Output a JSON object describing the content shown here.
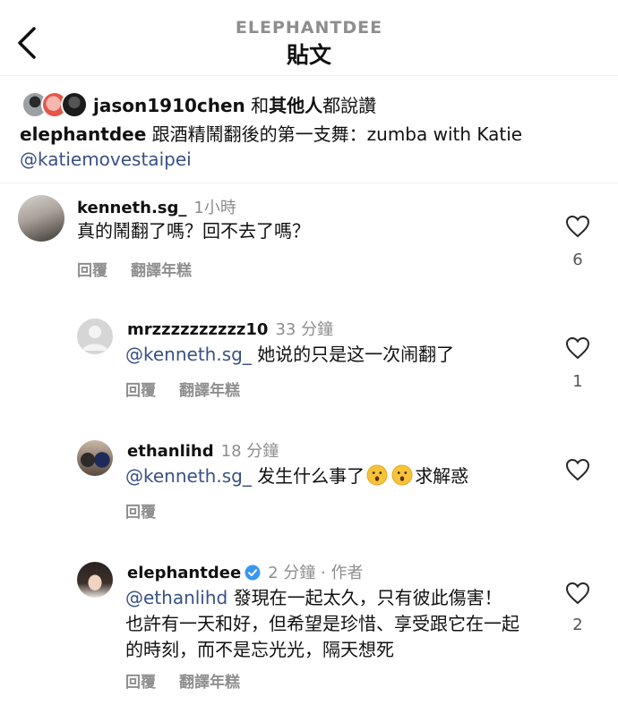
{
  "header": {
    "username": "ELEPHANTDEE",
    "title": "貼文"
  },
  "likes": {
    "user": "jason1910chen",
    "joiner": "和",
    "others": "其他人",
    "suffix": "都說讚"
  },
  "caption": {
    "username": "elephantdee",
    "text": "跟酒精鬧翻後的第一支舞：zumba with Katie",
    "mention": "@katiemovestaipei"
  },
  "comments": [
    {
      "username": "kenneth.sg_",
      "time": "1小時",
      "text": "真的鬧翻了嗎？回不去了嗎？",
      "reply": "回覆",
      "translate": "翻譯年糕",
      "likes": "6"
    },
    {
      "username": "mrzzzzzzzzzz10",
      "time": "33 分鐘",
      "mention": "@kenneth.sg_",
      "text": "她说的只是这一次闹翻了",
      "reply": "回覆",
      "translate": "翻譯年糕",
      "likes": "1"
    },
    {
      "username": "ethanlihd",
      "time": "18 分鐘",
      "mention": "@kenneth.sg_",
      "text_before": "发生什么事了",
      "text_after": "求解惑",
      "reply": "回覆",
      "likes": ""
    },
    {
      "username": "elephantdee",
      "time": "2 分鐘 · 作者",
      "mention": "@ethanlihd",
      "text": "發現在一起太久，只有彼此傷害！也許有一天和好，但希望是珍惜、享受跟它在一起的時刻，而不是忘光光，隔天想死",
      "reply": "回覆",
      "translate": "翻譯年糕",
      "likes": "2"
    }
  ],
  "colors": {
    "mention": "#385185",
    "verified": "#3897f0",
    "muted": "#8e8e8e"
  }
}
